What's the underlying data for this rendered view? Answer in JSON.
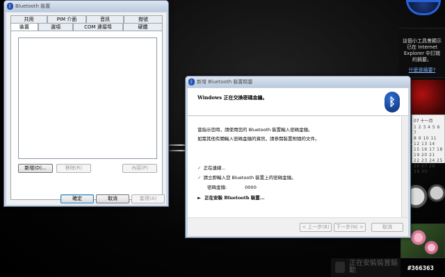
{
  "desktop": {
    "ie_gadget": {
      "message": "這個小工具會顯示已在 Internet Explorer 中訂閱的摘要。",
      "link": "什麼是摘要?"
    },
    "calendar": {
      "month": "07 十一月",
      "rows": [
        "1 2 3 4 5 6 7",
        "8 9 10 11 12 13 14",
        "15 16 17 18 19 20 21",
        "22 23 24 25 26 27 28",
        "29 30"
      ]
    },
    "taskbar_ghost": "正在安裝裝置驅動",
    "watermark": "#366363"
  },
  "devices_window": {
    "title": "Bluetooth 裝置",
    "tabs_row1": [
      "共用",
      "PIM 介面",
      "音訊",
      "撥號"
    ],
    "tabs_row2": [
      "裝置",
      "選項",
      "COM 連接埠",
      "硬體"
    ],
    "buttons": {
      "add": "新增(D)...",
      "remove": "移除(R)",
      "properties": "內容(P)",
      "ok": "確定",
      "cancel": "取消",
      "apply": "套用(A)"
    }
  },
  "wizard": {
    "title": "新增 Bluetooth 裝置精靈",
    "heading": "Windows 正在交換密碼金鑰。",
    "line1": "當指示您時，請使用您的 Bluetooth 裝置輸入密碼金鑰。",
    "line2": "如需其他有關輸入密碼金鑰的資訊，請參閱裝置附隨的文件。",
    "steps": {
      "connecting": "正在連線...",
      "enter_passkey": "請立即輸入您 Bluetooth 裝置上的密碼金鑰。",
      "passkey_label": "密碼金鑰:",
      "passkey_value": "0000",
      "installing": "正在安裝 Bluetooth 裝置..."
    },
    "buttons": {
      "back": "< 上一步(B)",
      "next": "下一步(N) >",
      "cancel": "取消"
    }
  }
}
